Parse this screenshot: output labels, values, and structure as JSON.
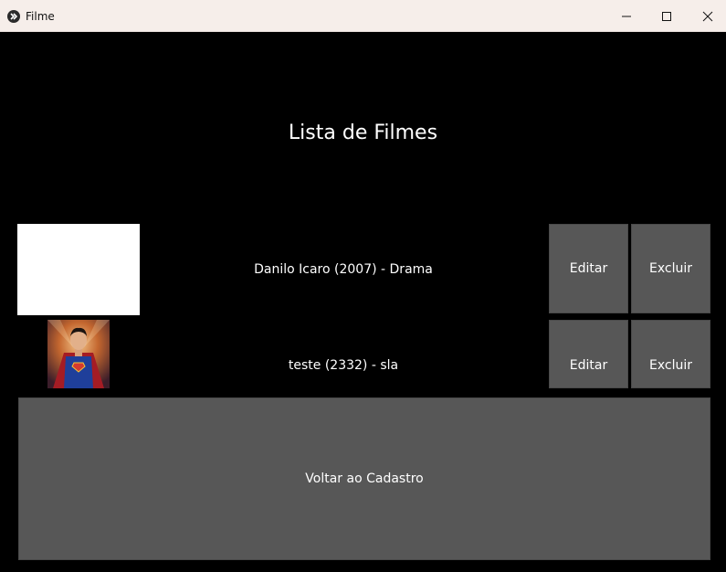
{
  "window": {
    "title": "Filme",
    "app_icon": "kivy-logo-icon",
    "controls": [
      "minimize-icon",
      "maximize-icon",
      "close-icon"
    ]
  },
  "page": {
    "title": "Lista de Filmes"
  },
  "movies": [
    {
      "label": "Danilo Icaro (2007) - Drama",
      "thumbnail": "blank-image",
      "edit_label": "Editar",
      "delete_label": "Excluir"
    },
    {
      "label": "teste (2332) - sla",
      "thumbnail": "superman-poster-image",
      "edit_label": "Editar",
      "delete_label": "Excluir"
    }
  ],
  "footer": {
    "back_label": "Voltar ao Cadastro"
  },
  "colors": {
    "background": "#000000",
    "titlebar": "#f6eeea",
    "button": "#575757",
    "text": "#ffffff"
  }
}
